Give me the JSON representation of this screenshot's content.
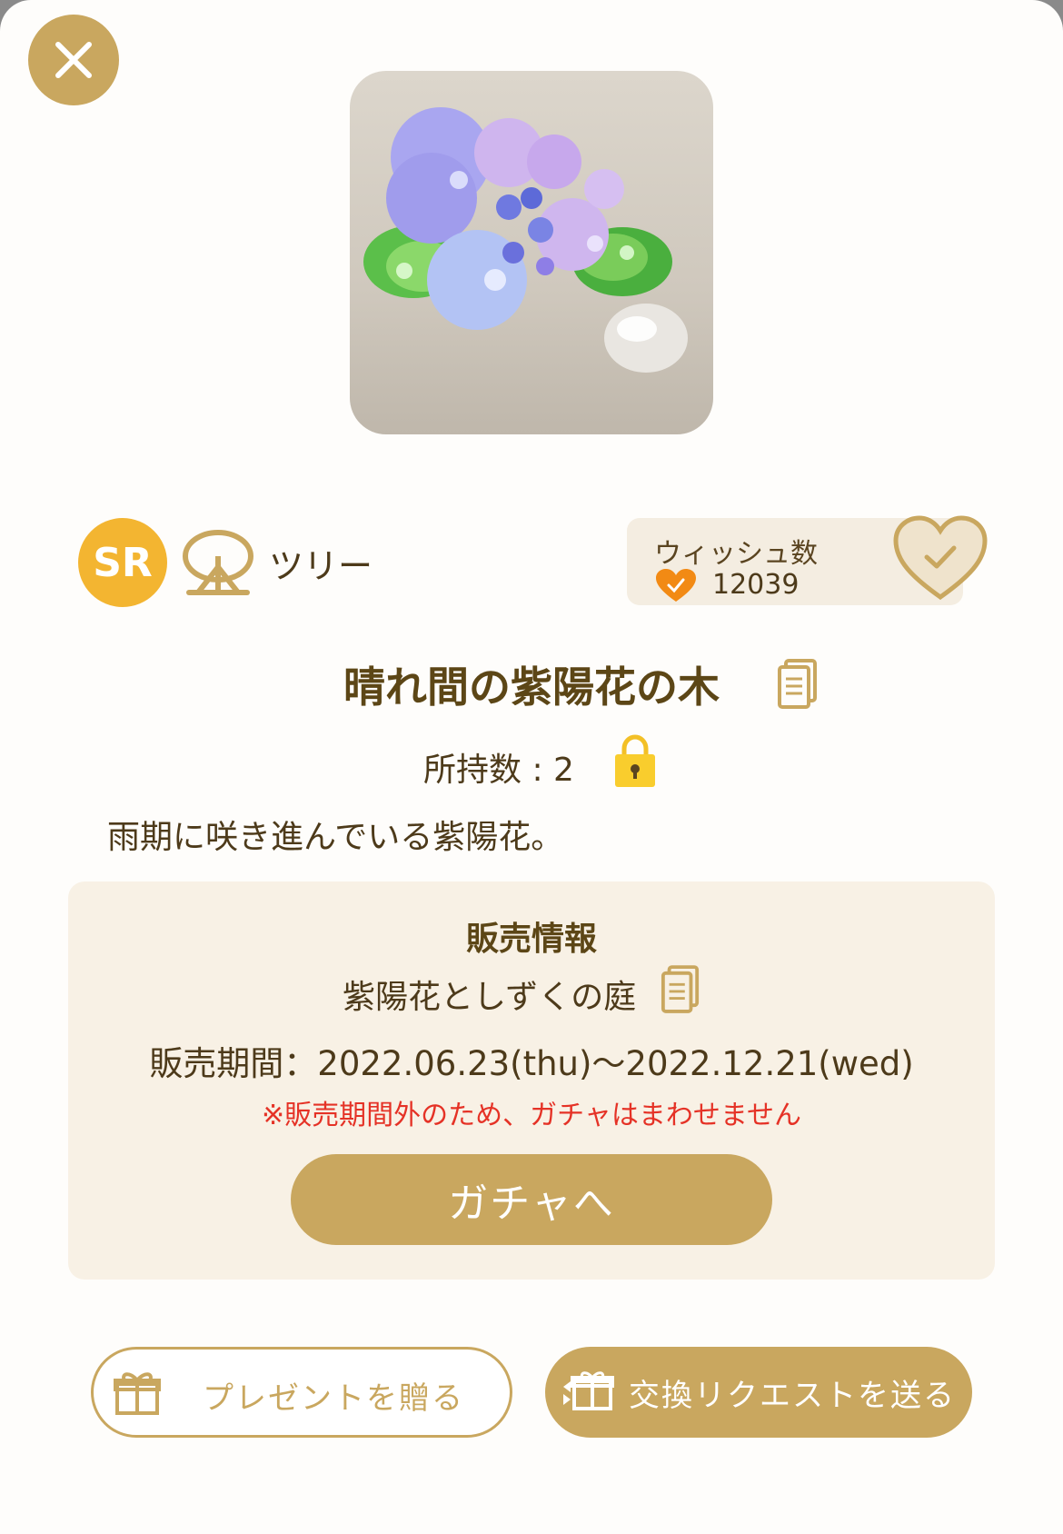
{
  "item": {
    "rarity": "SR",
    "category": "ツリー",
    "category_icon": "tree-icon",
    "name": "晴れ間の紫陽花の木",
    "owned_text": "所持数 : 2",
    "description": "雨期に咲き進んでいる紫陽花。"
  },
  "wish": {
    "label": "ウィッシュ数",
    "count": "12039"
  },
  "sale": {
    "heading": "販売情報",
    "gacha_name": "紫陽花としずくの庭",
    "period": "販売期間：2022.06.23(thu)〜2022.12.21(wed)",
    "note": "※販売期間外のため、ガチャはまわせません",
    "gacha_button": "ガチャへ"
  },
  "actions": {
    "present_label": "プレゼントを贈る",
    "trade_label": "交換リクエストを送る"
  },
  "colors": {
    "accent_gold": "#c9a75f",
    "rarity_sr": "#f3b531",
    "warning_red": "#e53226",
    "text_brown": "#4d3a1a"
  }
}
